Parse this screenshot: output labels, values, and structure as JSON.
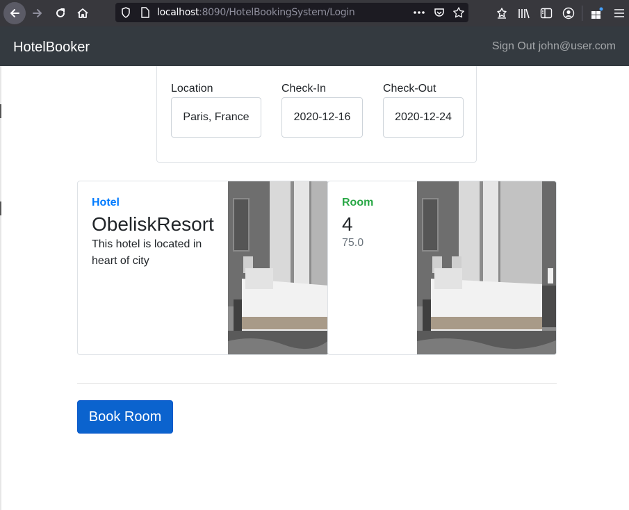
{
  "browser": {
    "url_host": "localhost",
    "url_rest": ":8090/HotelBookingSystem/Login",
    "icons": [
      "back-icon",
      "forward-icon",
      "reload-icon",
      "home-icon",
      "shield-icon",
      "page-icon",
      "more-icon",
      "pocket-icon",
      "bookmark-star-icon",
      "bookmarks-toolbar-icon",
      "library-icon",
      "sidebar-icon",
      "account-icon",
      "extensions-icon",
      "menu-icon"
    ]
  },
  "navbar": {
    "brand": "HotelBooker",
    "signout": "Sign Out john@user.com"
  },
  "search": {
    "location_label": "Location",
    "location_value": "Paris, France",
    "checkin_label": "Check-In",
    "checkin_value": "2020-12-16",
    "checkout_label": "Check-Out",
    "checkout_value": "2020-12-24"
  },
  "hotel": {
    "subtitle": "Hotel",
    "name": "ObeliskResort",
    "description": "This hotel is located in heart of city"
  },
  "room": {
    "subtitle": "Room",
    "number": "4",
    "price": "75.0"
  },
  "actions": {
    "book_label": "Book Room"
  },
  "colors": {
    "navbar_bg": "#343a40",
    "hotel_accent": "#007bff",
    "room_accent": "#28a745",
    "button_bg": "#0b63ce"
  }
}
